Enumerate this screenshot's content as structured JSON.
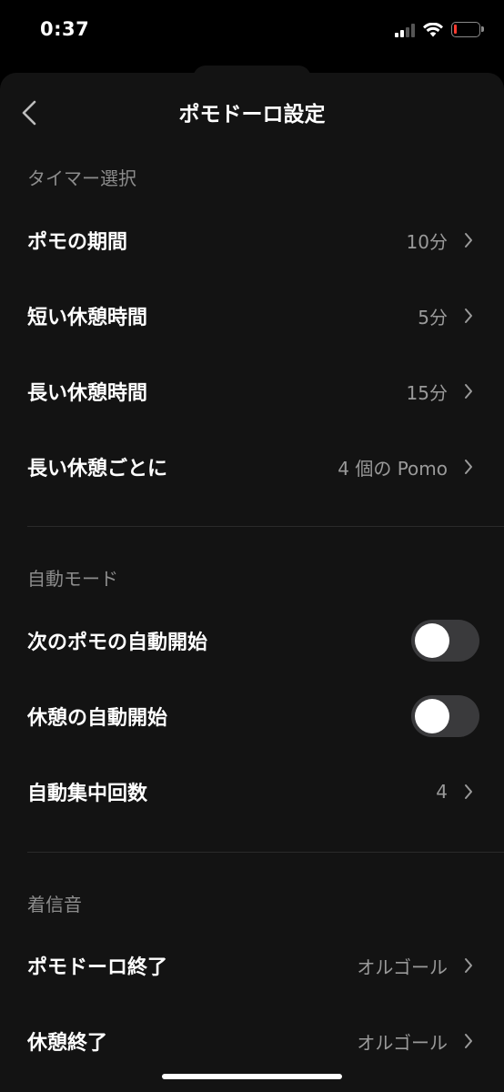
{
  "status_bar": {
    "time": "0:37",
    "signal_icon": "cellular-signal-icon",
    "wifi_icon": "wifi-icon",
    "battery_icon": "battery-low-icon",
    "battery_level": 0.1,
    "battery_color": "#ff3b30"
  },
  "nav": {
    "back_icon": "chevron-left-icon",
    "title": "ポモドーロ設定"
  },
  "sections": {
    "timer": {
      "header": "タイマー選択",
      "rows": [
        {
          "label": "ポモの期間",
          "value": "10分"
        },
        {
          "label": "短い休憩時間",
          "value": "5分"
        },
        {
          "label": "長い休憩時間",
          "value": "15分"
        },
        {
          "label": "長い休憩ごとに",
          "value": "4 個の Pomo"
        }
      ]
    },
    "auto": {
      "header": "自動モード",
      "toggles": [
        {
          "label": "次のポモの自動開始",
          "on": false
        },
        {
          "label": "休憩の自動開始",
          "on": false
        }
      ],
      "rows": [
        {
          "label": "自動集中回数",
          "value": "4"
        }
      ]
    },
    "sound": {
      "header": "着信音",
      "rows": [
        {
          "label": "ポモドーロ終了",
          "value": "オルゴール"
        },
        {
          "label": "休憩終了",
          "value": "オルゴール"
        }
      ]
    }
  },
  "colors": {
    "background": "#000000",
    "sheet": "#131313",
    "secondary_text": "#8c8c8c",
    "toggle_off": "#3a3a3c"
  }
}
